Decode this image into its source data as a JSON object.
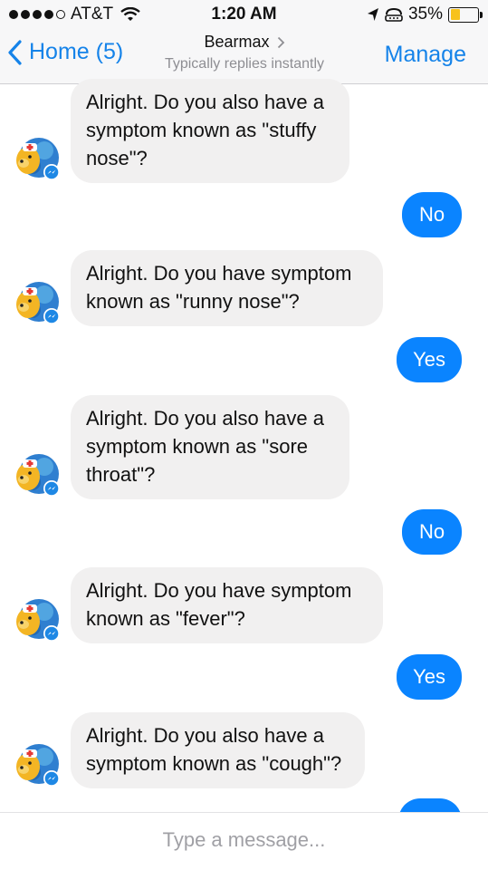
{
  "status_bar": {
    "carrier": "AT&T",
    "time": "1:20 AM",
    "battery": "35%",
    "battery_level": 0.35,
    "icons": [
      "signal-dots-icon",
      "wifi-icon",
      "location-arrow-icon",
      "alarm-icon",
      "battery-icon"
    ]
  },
  "nav": {
    "back_label": "Home (5)",
    "title": "Bearmax",
    "subtitle": "Typically replies instantly",
    "manage_label": "Manage",
    "accent": "#1583e9"
  },
  "messages": [
    {
      "from": "bot",
      "text": "Alright. Do you also have a symptom known as \"stuffy nose\"?"
    },
    {
      "from": "user",
      "text": "No"
    },
    {
      "from": "bot",
      "text": "Alright. Do you have symptom known as \"runny nose\"?"
    },
    {
      "from": "user",
      "text": "Yes"
    },
    {
      "from": "bot",
      "text": "Alright. Do you also have a symptom known as \"sore throat\"?"
    },
    {
      "from": "user",
      "text": "No"
    },
    {
      "from": "bot",
      "text": "Alright. Do you have symptom known as \"fever\"?"
    },
    {
      "from": "user",
      "text": "Yes"
    },
    {
      "from": "bot",
      "text": "Alright. Do you also have a symptom known as \"cough\"?"
    }
  ],
  "composer": {
    "placeholder": "Type a message..."
  },
  "colors": {
    "user_bubble": "#0a84ff",
    "bot_bubble": "#f1f0f0",
    "messenger_badge": "#1e88e5"
  }
}
